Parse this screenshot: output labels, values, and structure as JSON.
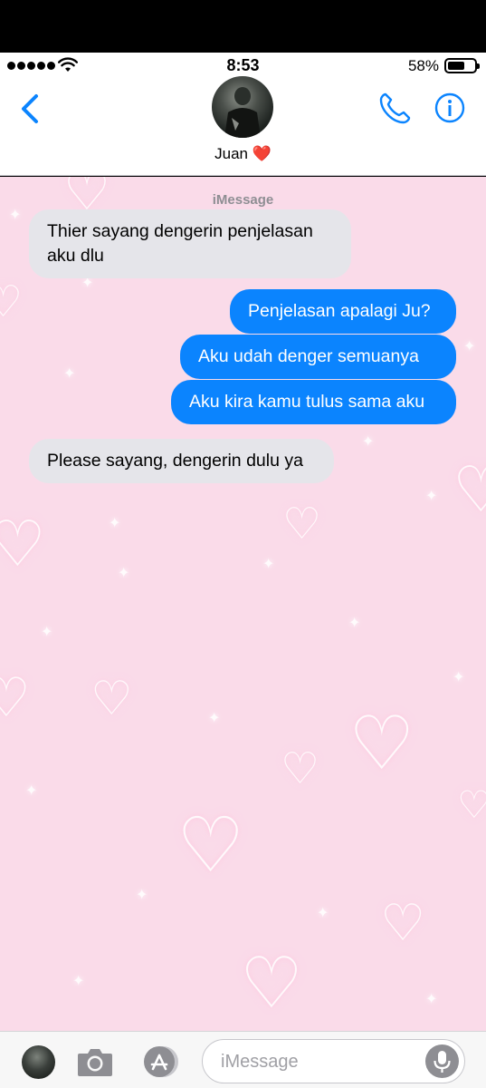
{
  "status_bar": {
    "time": "8:53",
    "battery_percent": "58%",
    "battery_level": 0.58,
    "signal_bars": 5
  },
  "header": {
    "contact_name": "Juan ❤️",
    "back_icon": "chevron-left-icon",
    "call_icon": "phone-icon",
    "info_icon": "info-icon",
    "accent_color": "#0b84fe"
  },
  "conversation": {
    "service_label": "iMessage",
    "background_color": "#fadbe9",
    "messages": [
      {
        "direction": "incoming",
        "text": "Thier sayang dengerin penjelasan aku dlu"
      },
      {
        "direction": "outgoing",
        "text": "Penjelasan apalagi Ju?"
      },
      {
        "direction": "outgoing",
        "text": "Aku udah denger semuanya"
      },
      {
        "direction": "outgoing",
        "text": "Aku kira kamu tulus sama aku"
      },
      {
        "direction": "incoming",
        "text": "Please sayang, dengerin dulu ya"
      }
    ]
  },
  "input_bar": {
    "placeholder": "iMessage",
    "value": "",
    "camera_icon": "camera-icon",
    "apps_icon": "app-store-icon",
    "mic_icon": "microphone-icon"
  },
  "colors": {
    "outgoing_bubble": "#0b84fe",
    "incoming_bubble": "#e5e5ea"
  }
}
